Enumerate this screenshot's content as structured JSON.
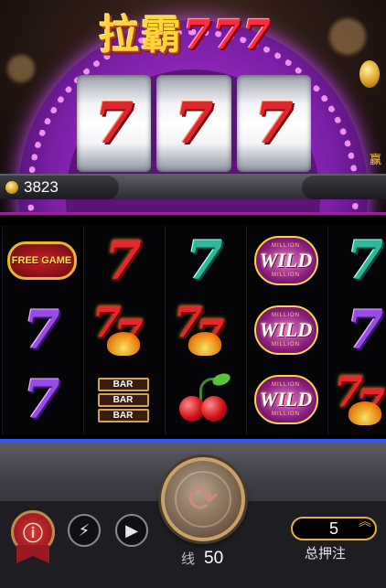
{
  "header": {
    "title": "拉霸",
    "title_number": "777",
    "win_label": "赢"
  },
  "balance": {
    "amount": "3823"
  },
  "jackpot_reels": [
    "7",
    "7",
    "7"
  ],
  "reels": [
    [
      {
        "kind": "free",
        "text": "FREE GAME"
      },
      {
        "kind": "seven",
        "color": "purple",
        "text": "7"
      },
      {
        "kind": "seven",
        "color": "purple",
        "text": "7"
      }
    ],
    [
      {
        "kind": "seven",
        "color": "red",
        "text": "7"
      },
      {
        "kind": "double",
        "text": "7"
      },
      {
        "kind": "bar",
        "text": "BAR"
      }
    ],
    [
      {
        "kind": "seven",
        "color": "teal",
        "text": "7"
      },
      {
        "kind": "double",
        "text": "7"
      },
      {
        "kind": "cherry"
      }
    ],
    [
      {
        "kind": "wild",
        "top": "MILLION",
        "text": "WILD",
        "bottom": "MILLION"
      },
      {
        "kind": "wild",
        "top": "MILLION",
        "text": "WILD",
        "bottom": "MILLION"
      },
      {
        "kind": "wild",
        "top": "MILLION",
        "text": "WILD",
        "bottom": "MILLION"
      }
    ],
    [
      {
        "kind": "seven",
        "color": "teal",
        "text": "7"
      },
      {
        "kind": "seven",
        "color": "purple",
        "text": "7"
      },
      {
        "kind": "double",
        "text": "7"
      }
    ]
  ],
  "controls": {
    "info_icon": "info-icon",
    "turbo_icon": "lightning-icon",
    "auto_icon": "play-icon",
    "spin_icon": "refresh-icon",
    "lines_label": "线",
    "lines_value": "50",
    "bet_value": "5",
    "bet_label": "总押注"
  },
  "colors": {
    "accent_gold": "#e2b13a",
    "dome_purple": "#a030c8",
    "frame_blue": "#2e58ff"
  }
}
